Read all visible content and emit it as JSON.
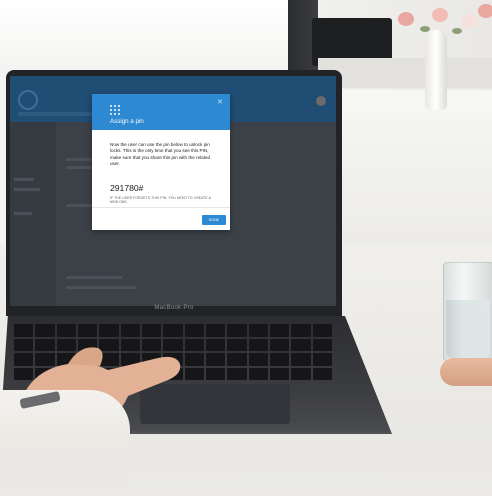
{
  "laptop": {
    "brand": "MacBook Pro"
  },
  "modal": {
    "title": "Assign a pin",
    "close_icon": "close-icon",
    "description": "Now the user can use the pin below to unlock pin locks. This is the only time that you see this PIN, make sure that you share this pin with the related user.",
    "pin": "291780#",
    "note": "IF THE USER FORGETS THIS PIN, YOU NEED TO CREATE A NEW ONE.",
    "done_label": "DONE",
    "icon": "keypad-icon"
  },
  "colors": {
    "modal_header": "#2d89d1",
    "done_button": "#2d89d1",
    "app_header": "#1f4d73",
    "overlay": "#3a4046"
  }
}
